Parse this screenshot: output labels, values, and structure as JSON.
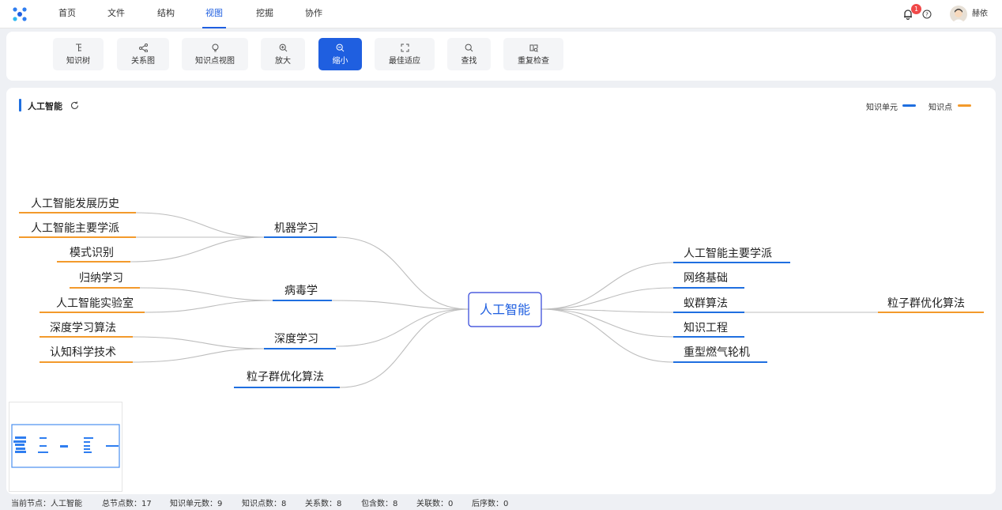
{
  "nav": {
    "items": [
      "首页",
      "文件",
      "结构",
      "视图",
      "挖掘",
      "协作"
    ],
    "active_index": 3,
    "notification_count": "1",
    "user_name": "赫依"
  },
  "toolbar": {
    "buttons": [
      {
        "label": "知识树",
        "icon": "tree-icon"
      },
      {
        "label": "关系图",
        "icon": "graph-icon"
      },
      {
        "label": "知识点视图",
        "icon": "bulb-icon"
      },
      {
        "label": "放大",
        "icon": "zoom-in-icon"
      },
      {
        "label": "缩小",
        "icon": "zoom-out-icon"
      },
      {
        "label": "最佳适应",
        "icon": "fit-icon"
      },
      {
        "label": "查找",
        "icon": "search-icon"
      },
      {
        "label": "重复检查",
        "icon": "duplicate-check-icon"
      }
    ],
    "active_index": 4
  },
  "panel": {
    "title": "人工智能",
    "legend": [
      {
        "label": "知识单元",
        "color": "#1f6fe0"
      },
      {
        "label": "知识点",
        "color": "#f39a2b"
      }
    ]
  },
  "mindmap": {
    "root": "人工智能",
    "left_units": [
      {
        "label": "机器学习",
        "points": [
          "人工智能发展历史",
          "人工智能主要学派",
          "模式识别"
        ]
      },
      {
        "label": "病毒学",
        "points": [
          "归纳学习",
          "人工智能实验室"
        ]
      },
      {
        "label": "深度学习",
        "points": [
          "深度学习算法",
          "认知科学技术"
        ]
      },
      {
        "label": "粒子群优化算法",
        "points": []
      }
    ],
    "right_units": [
      {
        "label": "人工智能主要学派",
        "points": []
      },
      {
        "label": "网络基础",
        "points": []
      },
      {
        "label": "蚁群算法",
        "points": [
          "粒子群优化算法"
        ]
      },
      {
        "label": "知识工程",
        "points": []
      },
      {
        "label": "重型燃气轮机",
        "points": []
      }
    ]
  },
  "status": {
    "current_node": "当前节点：人工智能",
    "total_nodes": "总节点数：17",
    "unit_count": "知识单元数：9",
    "point_count": "知识点数：8",
    "relation_count": "关系数：8",
    "contain_count": "包含数：8",
    "association_count": "关联数：0",
    "sequence_count": "后序数：0"
  }
}
